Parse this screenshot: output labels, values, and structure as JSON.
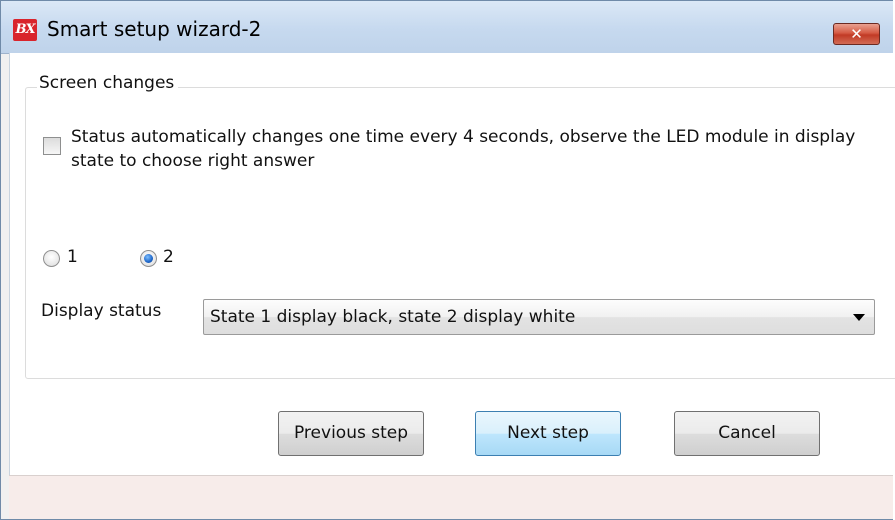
{
  "window": {
    "title": "Smart setup wizard-2",
    "app_icon_text": "BX",
    "close_glyph": "✕"
  },
  "group": {
    "legend": "Screen changes",
    "checkbox": {
      "label": "Status automatically changes one time every 4 seconds, observe the LED module in display state to choose right answer",
      "checked": false
    },
    "radios": [
      {
        "label": "1",
        "checked": false
      },
      {
        "label": "2",
        "checked": true
      }
    ],
    "display_status": {
      "label": "Display status",
      "selected": "State 1 display black, state 2 display white"
    }
  },
  "buttons": {
    "previous": "Previous step",
    "next": "Next step",
    "cancel": "Cancel"
  },
  "colors": {
    "close_button": "#d55a44",
    "radio_selected": "#1e66c8",
    "default_button": "#bee6fd"
  }
}
